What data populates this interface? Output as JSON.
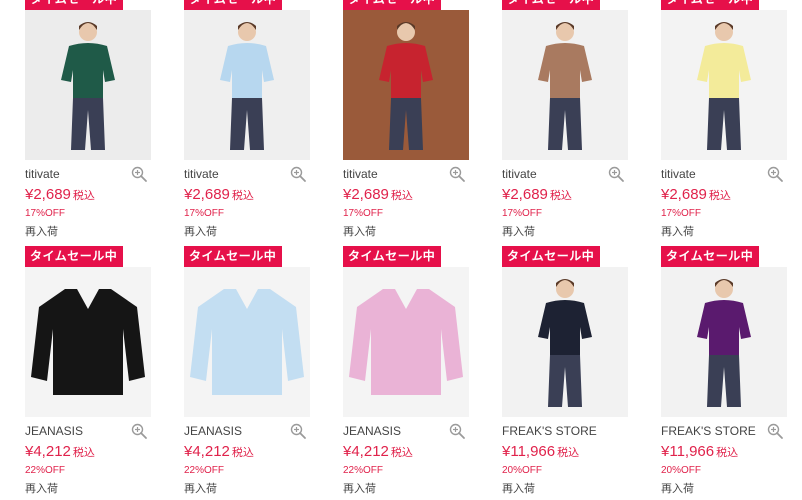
{
  "products": [
    {
      "brand": "titivate",
      "price": "¥2,689",
      "tax": "税込",
      "discount": "17%OFF",
      "status": "再入荷",
      "badge": "タイムセール中",
      "item_color": "#1f5a48",
      "bg_color": "#ececec"
    },
    {
      "brand": "titivate",
      "price": "¥2,689",
      "tax": "税込",
      "discount": "17%OFF",
      "status": "再入荷",
      "badge": "タイムセール中",
      "item_color": "#b7d7ef",
      "bg_color": "#efefef"
    },
    {
      "brand": "titivate",
      "price": "¥2,689",
      "tax": "税込",
      "discount": "17%OFF",
      "status": "再入荷",
      "badge": "タイムセール中",
      "item_color": "#c7232f",
      "bg_color": "#9a5a3a"
    },
    {
      "brand": "titivate",
      "price": "¥2,689",
      "tax": "税込",
      "discount": "17%OFF",
      "status": "再入荷",
      "badge": "タイムセール中",
      "item_color": "#a97a60",
      "bg_color": "#f1f1f1"
    },
    {
      "brand": "titivate",
      "price": "¥2,689",
      "tax": "税込",
      "discount": "17%OFF",
      "status": "再入荷",
      "badge": "タイムセール中",
      "item_color": "#f3eb9a",
      "bg_color": "#f3f3f3"
    },
    {
      "brand": "JEANASIS",
      "price": "¥4,212",
      "tax": "税込",
      "discount": "22%OFF",
      "status": "再入荷",
      "badge": "タイムセール中",
      "item_color": "#151515",
      "bg_color": "#f4f4f4"
    },
    {
      "brand": "JEANASIS",
      "price": "¥4,212",
      "tax": "税込",
      "discount": "22%OFF",
      "status": "再入荷",
      "badge": "タイムセール中",
      "item_color": "#c3def2",
      "bg_color": "#f4f4f4"
    },
    {
      "brand": "JEANASIS",
      "price": "¥4,212",
      "tax": "税込",
      "discount": "22%OFF",
      "status": "再入荷",
      "badge": "タイムセール中",
      "item_color": "#eab3d6",
      "bg_color": "#f4f4f4"
    },
    {
      "brand": "FREAK'S STORE",
      "price": "¥11,966",
      "tax": "税込",
      "discount": "20%OFF",
      "status": "再入荷",
      "badge": "タイムセール中",
      "item_color": "#1d2233",
      "bg_color": "#f2f2f2"
    },
    {
      "brand": "FREAK'S STORE",
      "price": "¥11,966",
      "tax": "税込",
      "discount": "20%OFF",
      "status": "再入荷",
      "badge": "タイムセール中",
      "item_color": "#5a1a6e",
      "bg_color": "#f2f2f2"
    }
  ],
  "icons": {
    "zoom": "zoom-in-icon"
  }
}
